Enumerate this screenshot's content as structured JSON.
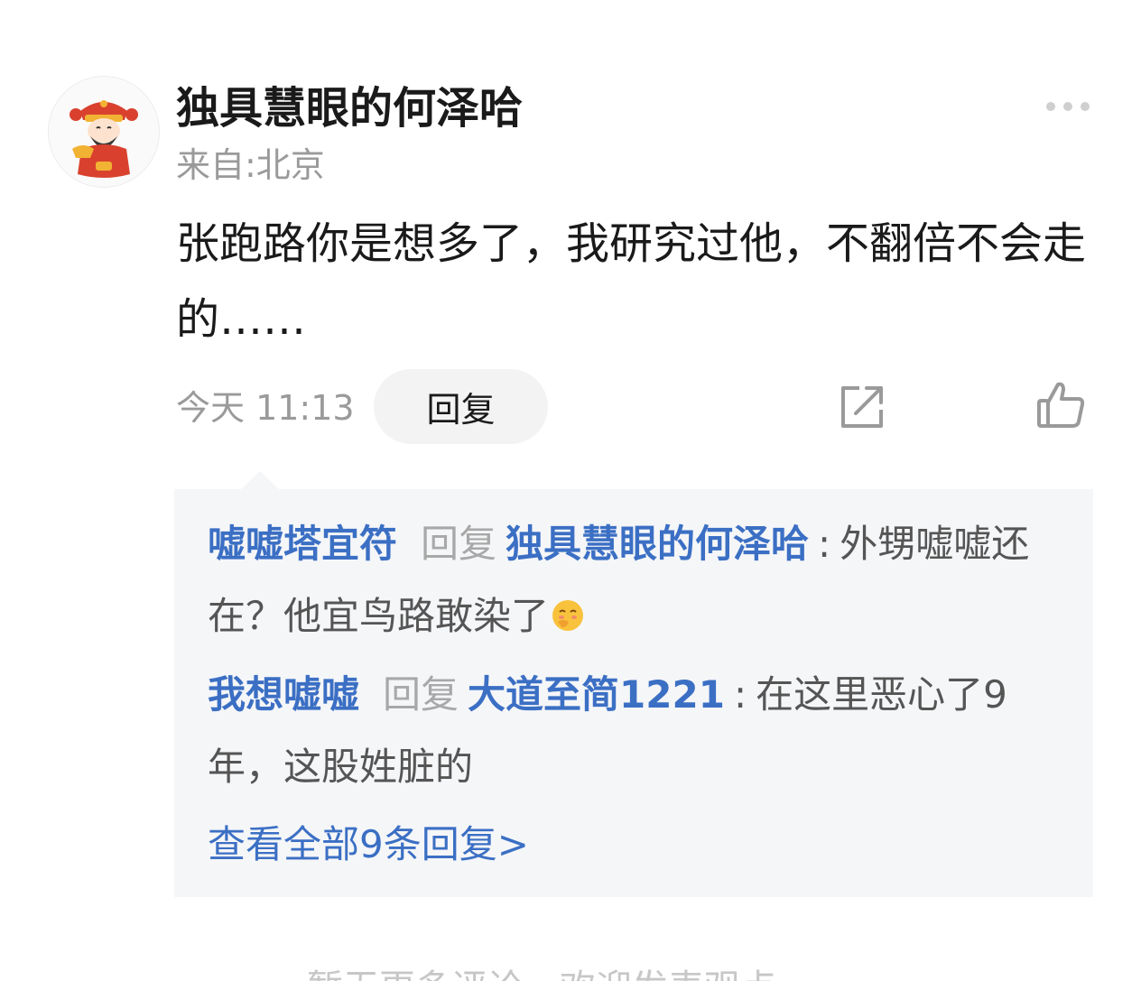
{
  "comment": {
    "username": "独具慧眼的何泽哈",
    "location": "来自:北京",
    "text": "张跑路你是想多了，我研究过他，不翻倍不会走的……",
    "timestamp": "今天 11:13",
    "reply_label": "回复",
    "avatar_icon": "god-of-wealth-avatar",
    "more_icon": "more-dots-icon",
    "share_icon": "share-icon",
    "like_icon": "thumbs-up-icon"
  },
  "replies": [
    {
      "author": "嘘嘘塔宜符",
      "verb": "回复",
      "target": "独具慧眼的何泽哈",
      "separator": ":",
      "text": "外甥嘘嘘还在？他宜鸟路敢染了",
      "emoji": "smiling-face-emoji"
    },
    {
      "author": "我想嘘嘘",
      "verb": "回复",
      "target": "大道至简1221",
      "separator": ":",
      "text": "在这里恶心了9年，这股姓脏的"
    }
  ],
  "view_all_label": "查看全部9条回复>",
  "bottom_hint": "暂无更多评论，欢迎发表观点",
  "colors": {
    "link_blue": "#3b6fc4",
    "text_primary": "#1a1a1a",
    "text_secondary": "#9a9a9a",
    "panel_bg": "#f5f6f8"
  }
}
